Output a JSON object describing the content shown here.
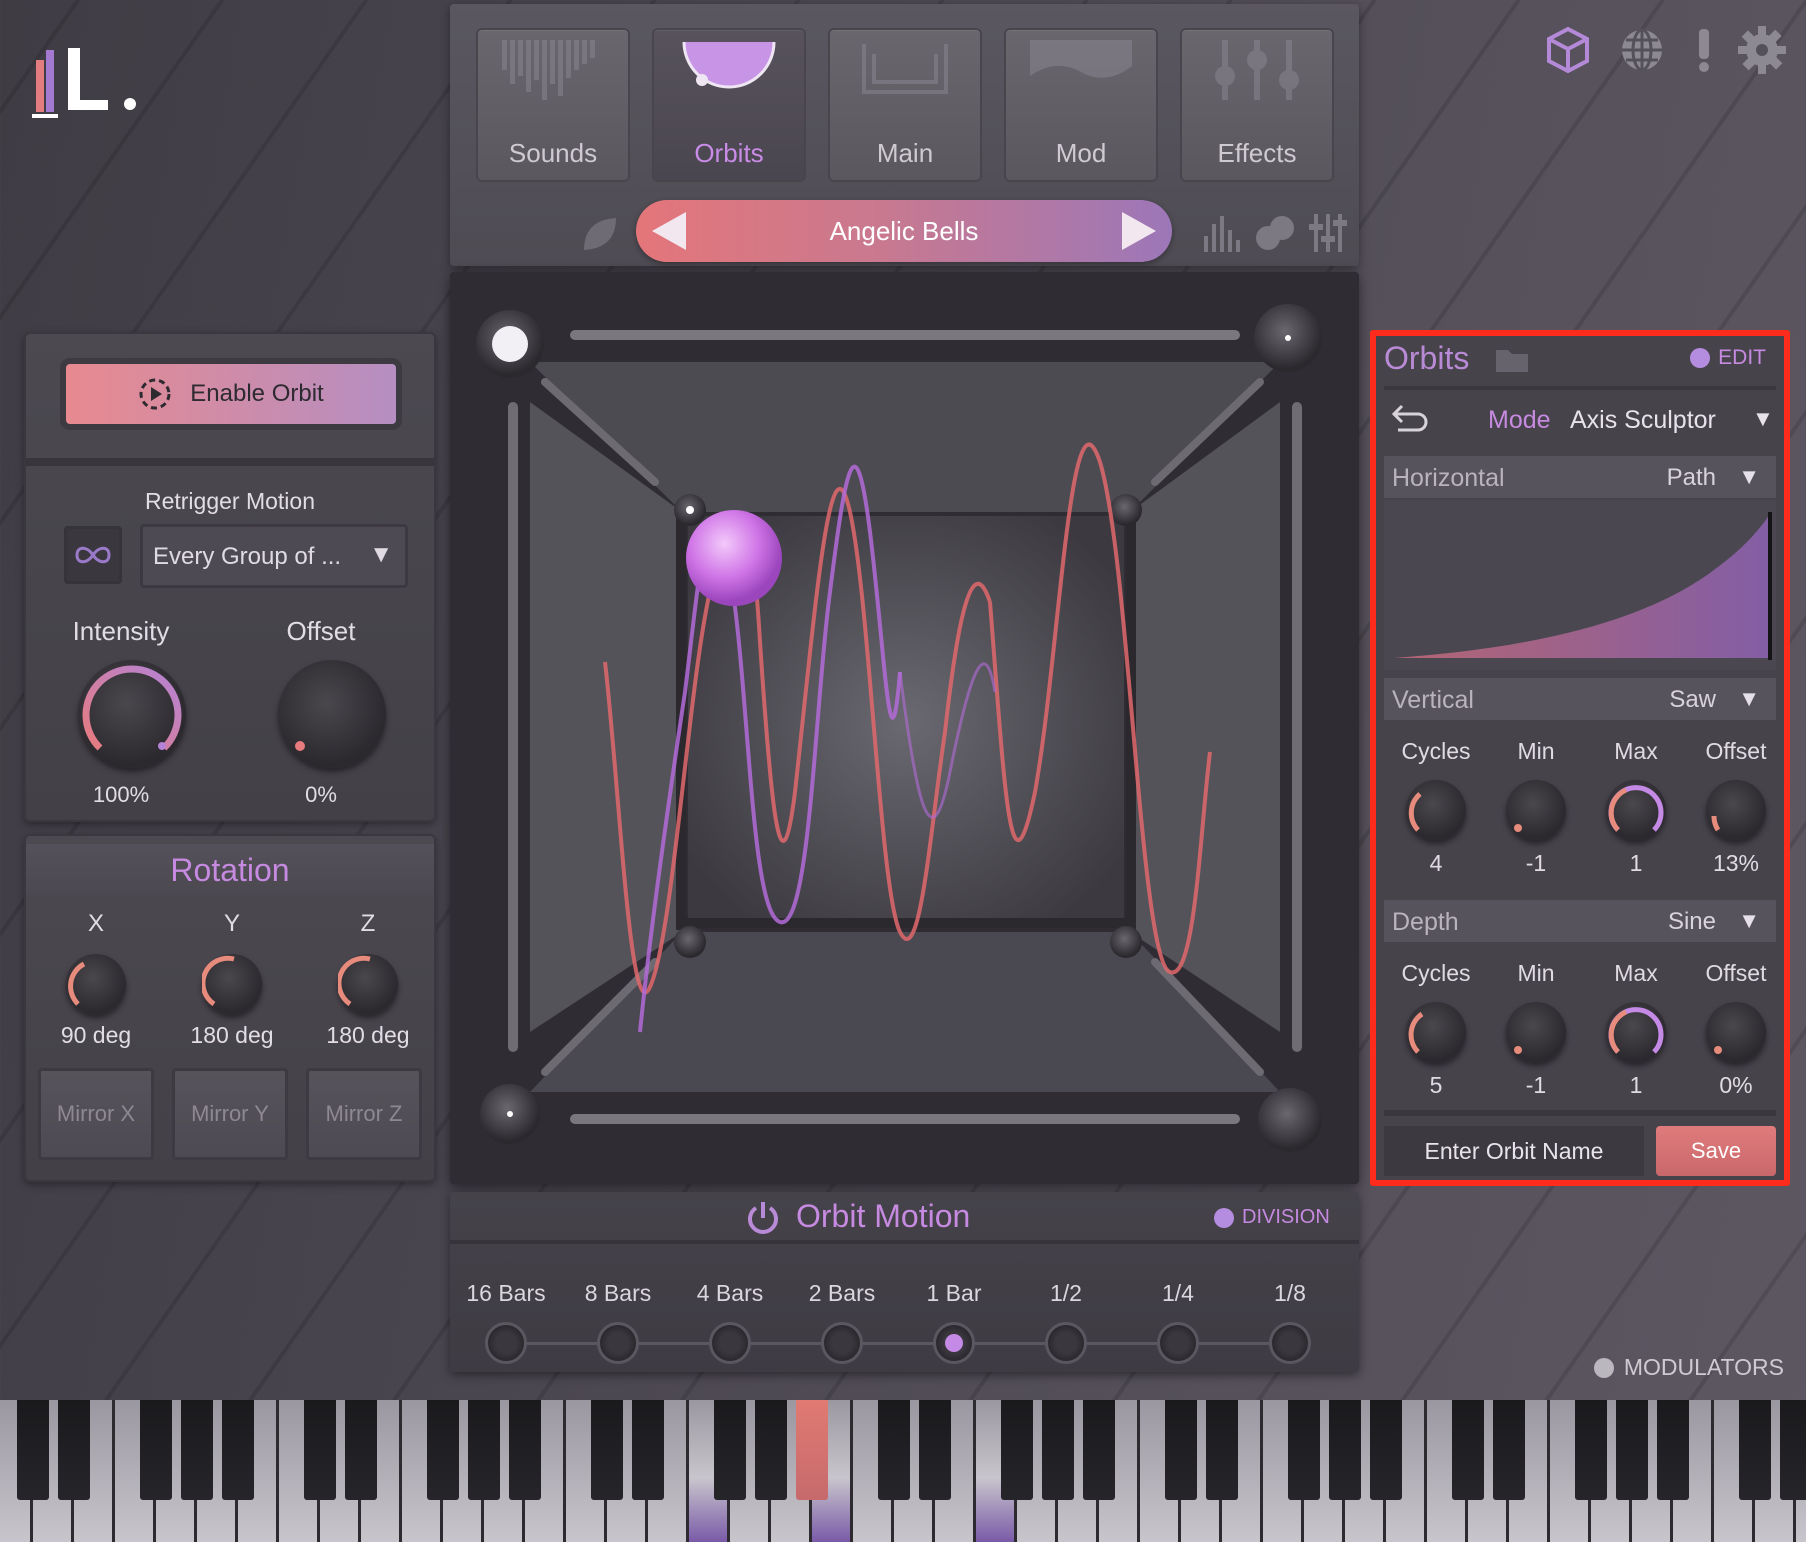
{
  "tabs": [
    {
      "label": "Sounds"
    },
    {
      "label": "Orbits"
    },
    {
      "label": "Main"
    },
    {
      "label": "Mod"
    },
    {
      "label": "Effects"
    }
  ],
  "active_tab": "Orbits",
  "preset": {
    "name": "Angelic Bells"
  },
  "top_icons": [
    "cube-icon",
    "globe-icon",
    "alert-icon",
    "gear-icon"
  ],
  "left": {
    "enable_label": "Enable Orbit",
    "retrigger_label": "Retrigger Motion",
    "retrigger_value": "Every Group of ...",
    "intensity_label": "Intensity",
    "intensity_value": "100%",
    "offset_label": "Offset",
    "offset_value": "0%"
  },
  "rotation": {
    "title": "Rotation",
    "axes": [
      {
        "label": "X",
        "value": "90 deg"
      },
      {
        "label": "Y",
        "value": "180 deg"
      },
      {
        "label": "Z",
        "value": "180 deg"
      }
    ],
    "mirrors": [
      "Mirror X",
      "Mirror Y",
      "Mirror Z"
    ]
  },
  "motion": {
    "title": "Orbit Motion",
    "division_label": "DIVISION",
    "divisions": [
      "16 Bars",
      "8 Bars",
      "4 Bars",
      "2 Bars",
      "1 Bar",
      "1/2",
      "1/4",
      "1/8"
    ],
    "selected": "1 Bar"
  },
  "orbits_panel": {
    "title": "Orbits",
    "edit_label": "EDIT",
    "mode_label": "Mode",
    "mode_value": "Axis Sculptor",
    "horizontal": {
      "label": "Horizontal",
      "value": "Path"
    },
    "vertical": {
      "label": "Vertical",
      "value": "Saw",
      "params": [
        {
          "label": "Cycles",
          "value": "4"
        },
        {
          "label": "Min",
          "value": "-1"
        },
        {
          "label": "Max",
          "value": "1"
        },
        {
          "label": "Offset",
          "value": "13%"
        }
      ]
    },
    "depth": {
      "label": "Depth",
      "value": "Sine",
      "params": [
        {
          "label": "Cycles",
          "value": "5"
        },
        {
          "label": "Min",
          "value": "-1"
        },
        {
          "label": "Max",
          "value": "1"
        },
        {
          "label": "Offset",
          "value": "0%"
        }
      ]
    },
    "name_placeholder": "Enter Orbit Name",
    "save_label": "Save"
  },
  "modulators_label": "MODULATORS",
  "colors": {
    "accent": "#c48ae6",
    "highlight": "#ff2b1c",
    "preset_start": "#e4767a",
    "preset_end": "#9c77b8"
  }
}
